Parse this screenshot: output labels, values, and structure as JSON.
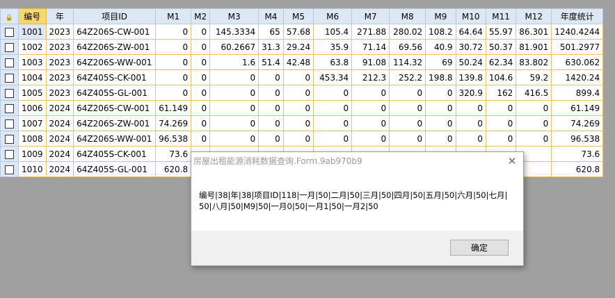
{
  "grid": {
    "columns": [
      "编号",
      "年",
      "项目ID",
      "M1",
      "M2",
      "M3",
      "M4",
      "M5",
      "M6",
      "M7",
      "M8",
      "M9",
      "M10",
      "M11",
      "M12",
      "年度统计"
    ],
    "selected_column": "编号",
    "rows": [
      [
        "1001",
        "2023",
        "64Z206S-CW-001",
        "0",
        "0",
        "145.3334",
        "65",
        "57.68",
        "105.4",
        "271.88",
        "280.02",
        "108.2",
        "64.64",
        "55.97",
        "86.301",
        "1240.4244"
      ],
      [
        "1002",
        "2023",
        "64Z206S-ZW-001",
        "0",
        "0",
        "60.2667",
        "31.3",
        "29.24",
        "35.9",
        "71.14",
        "69.56",
        "40.9",
        "30.72",
        "50.37",
        "81.901",
        "501.2977"
      ],
      [
        "1003",
        "2023",
        "64Z206S-WW-001",
        "0",
        "0",
        "1.6",
        "51.4",
        "42.48",
        "63.8",
        "91.08",
        "114.32",
        "69",
        "50.24",
        "62.34",
        "83.802",
        "630.062"
      ],
      [
        "1004",
        "2023",
        "64Z405S-CK-001",
        "0",
        "0",
        "0",
        "0",
        "0",
        "453.34",
        "212.3",
        "252.2",
        "198.8",
        "139.8",
        "104.6",
        "59.2",
        "1420.24"
      ],
      [
        "1005",
        "2023",
        "64Z405S-GL-001",
        "0",
        "0",
        "0",
        "0",
        "0",
        "0",
        "0",
        "0",
        "0",
        "320.9",
        "162",
        "416.5",
        "899.4"
      ],
      [
        "1006",
        "2024",
        "64Z206S-CW-001",
        "61.149",
        "0",
        "0",
        "0",
        "0",
        "0",
        "0",
        "0",
        "0",
        "0",
        "0",
        "0",
        "61.149"
      ],
      [
        "1007",
        "2024",
        "64Z206S-ZW-001",
        "74.269",
        "0",
        "0",
        "0",
        "0",
        "0",
        "0",
        "0",
        "0",
        "0",
        "0",
        "0",
        "74.269"
      ],
      [
        "1008",
        "2024",
        "64Z206S-WW-001",
        "96.538",
        "0",
        "0",
        "0",
        "0",
        "0",
        "0",
        "0",
        "0",
        "0",
        "0",
        "0",
        "96.538"
      ],
      [
        "1009",
        "2024",
        "64Z405S-CK-001",
        "73.6",
        "",
        "",
        "",
        "",
        "",
        "",
        "",
        "",
        "",
        "",
        "",
        "73.6"
      ],
      [
        "1010",
        "2024",
        "64Z405S-GL-001",
        "620.8",
        "",
        "",
        "",
        "",
        "",
        "",
        "",
        "",
        "",
        "",
        "",
        "620.8"
      ]
    ]
  },
  "dialog": {
    "title": "房屋出租能源消耗数据查询.Form.9ab970b9",
    "message": "编号|38|年|38|项目ID|118|一月|50|二月|50|三月|50|四月|50|五月|50|六月|50|七月|50|八月|50|M9|50|一月0|50|一月1|50|一月2|50",
    "ok_label": "确定",
    "close_icon": "close-icon"
  }
}
